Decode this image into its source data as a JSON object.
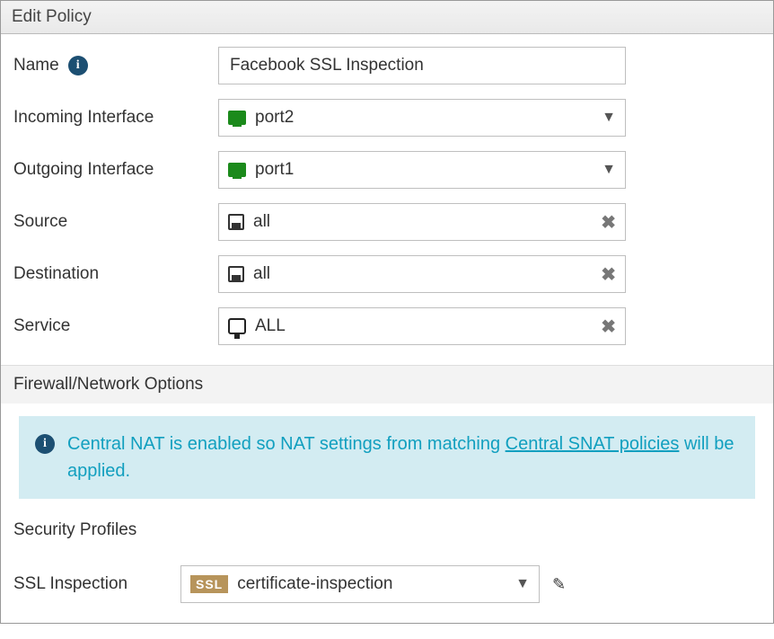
{
  "header": {
    "title": "Edit Policy"
  },
  "fields": {
    "name": {
      "label": "Name",
      "value": "Facebook SSL Inspection"
    },
    "incoming": {
      "label": "Incoming Interface",
      "value": "port2"
    },
    "outgoing": {
      "label": "Outgoing Interface",
      "value": "port1"
    },
    "source": {
      "label": "Source",
      "value": "all"
    },
    "destination": {
      "label": "Destination",
      "value": "all"
    },
    "service": {
      "label": "Service",
      "value": "ALL"
    }
  },
  "sections": {
    "firewall": "Firewall/Network Options",
    "security": "Security Profiles"
  },
  "notice": {
    "pre": "Central NAT is enabled so NAT settings from matching ",
    "link": "Central SNAT policies",
    "post": " will be applied."
  },
  "ssl": {
    "label": "SSL Inspection",
    "badge": "SSL",
    "value": "certificate-inspection"
  },
  "glyphs": {
    "info": "i",
    "caret": "▼",
    "close": "✖",
    "pencil": "✎"
  }
}
